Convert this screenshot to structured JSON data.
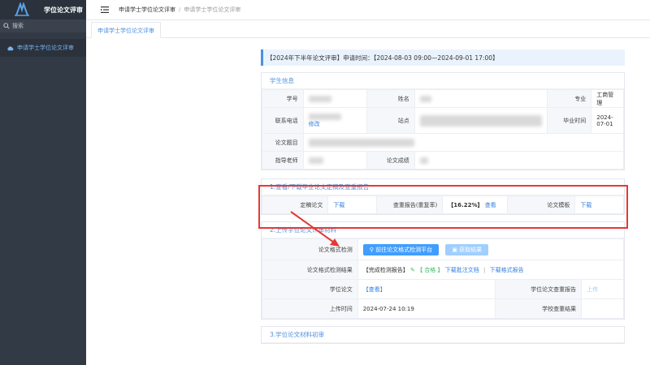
{
  "app": {
    "title": "学位论文评审"
  },
  "sidebar": {
    "search_label": "搜索",
    "items": [
      {
        "label": "申请学士学位论文评审"
      }
    ]
  },
  "breadcrumb": {
    "root": "申请学士学位论文评审",
    "separator": "/",
    "current": "申请学士学位论文评审"
  },
  "tabs": [
    {
      "label": "申请学士学位论文评审"
    }
  ],
  "notice": {
    "text": "【2024年下半年论文评审】申请时间：【2024-08-03 09:00—2024-09-01 17:00】"
  },
  "student": {
    "title": "学生信息",
    "labels": {
      "id": "学号",
      "name": "姓名",
      "major": "专业",
      "phone": "联系电话",
      "campus": "站点",
      "grad_time": "毕业时间",
      "thesis_title": "论文题目",
      "advisor": "指导老师",
      "score": "论文成绩"
    },
    "values": {
      "major": "工商管理",
      "phone_edit": "修改",
      "grad_time": "2024-07-01"
    }
  },
  "section1": {
    "title": "1.查看/下载毕业论文定稿及查重报告",
    "final_label": "定稿论文",
    "final_action": "下载",
    "report_label": "查重报告(重复率)",
    "report_rate": "【16.22%】",
    "report_action": "查看",
    "template_label": "论文模板",
    "template_action": "下载"
  },
  "section2": {
    "title": "2.上传学位论文评审材料",
    "format_check_label": "论文格式检测",
    "btn_goto": "前往论文格式检测平台",
    "btn_fetch": "获取结果",
    "format_result_label": "论文格式检测结果",
    "result_prefix": "【完成检测报告】",
    "result_pass": "【 合格 】",
    "download_annotated": "下载批注文档",
    "divider": "|",
    "download_report": "下载格式报告",
    "thesis_label": "学位论文",
    "thesis_view": "【查看】",
    "plag_label": "学位论文查重报告",
    "plag_upload": "上传",
    "upload_time_label": "上传时间",
    "upload_time": "2024-07-24 10:19",
    "school_check_label": "学校查重结果"
  },
  "section3": {
    "title": "3.学位论文材料初审"
  }
}
